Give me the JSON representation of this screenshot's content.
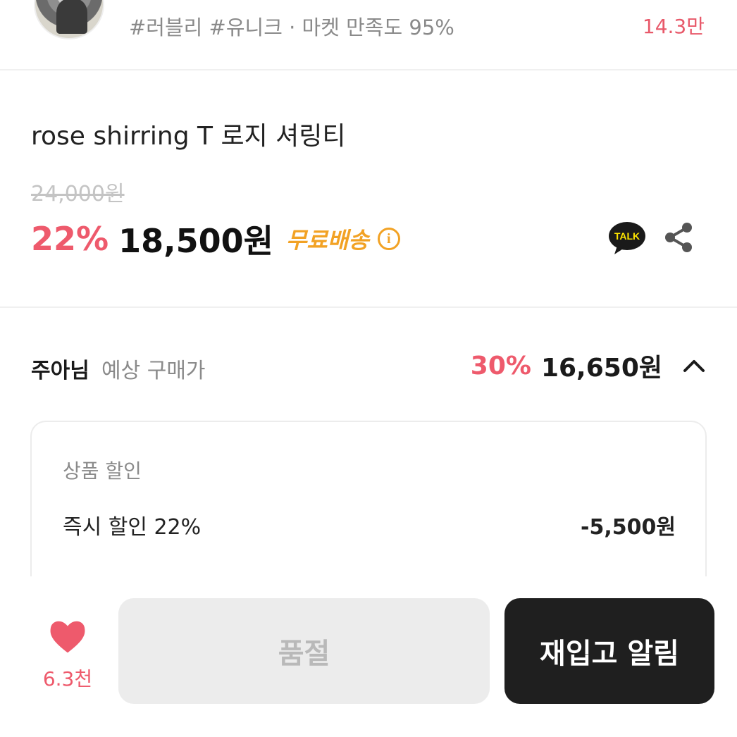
{
  "shop": {
    "tags_text": "#러블리 #유니크 · 마켓 만족도 95%",
    "likes": "14.3만"
  },
  "product": {
    "title": "rose shirring T 로지 셔링티",
    "original_price": "24,000원",
    "discount_rate": "22%",
    "sale_price": "18,500원",
    "shipping_badge": "무료배송",
    "info_icon": "i"
  },
  "actions": {
    "kakao_label": "TALK",
    "kakao_icon": "kakao-talk-icon",
    "share_icon": "share-icon"
  },
  "expected": {
    "user_name": "주아님",
    "label": "예상 구매가",
    "rate": "30%",
    "price": "16,650원",
    "toggle_icon": "chevron-up-icon"
  },
  "discounts": {
    "section_title": "상품 할인",
    "items": [
      {
        "label": "즉시 할인 22%",
        "amount": "-5,500원"
      }
    ]
  },
  "bottom": {
    "like_count": "6.3천",
    "soldout_label": "품절",
    "restock_label": "재입고 알림"
  },
  "colors": {
    "accent_pink": "#ee5a6c",
    "shipping_orange": "#f2a224",
    "kakao_yellow": "#fee500",
    "dark_button": "#1f1f1f",
    "disabled_button": "#ececec"
  }
}
